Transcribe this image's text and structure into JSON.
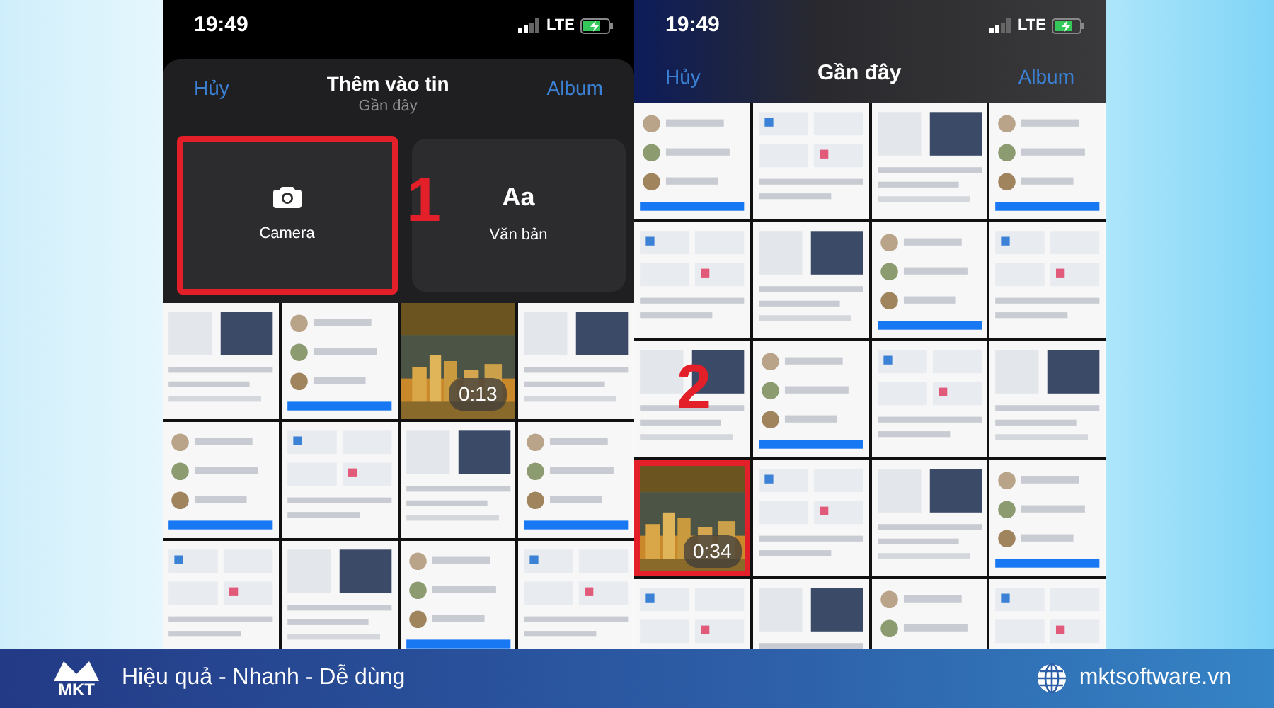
{
  "phones": [
    {
      "status": {
        "time": "19:49",
        "network": "LTE"
      },
      "header": {
        "cancel": "Hủy",
        "title": "Thêm vào tin",
        "subtitle": "Gần đây",
        "album": "Album"
      },
      "options": [
        {
          "kind": "camera",
          "label": "Camera",
          "highlighted": true
        },
        {
          "kind": "text",
          "icon": "Aa",
          "label": "Văn bản",
          "highlighted": false
        }
      ],
      "step": "1",
      "thumbnails": [
        {
          "kind": "picture",
          "highlighted": false
        },
        {
          "kind": "picture",
          "highlighted": false
        },
        {
          "kind": "picture",
          "duration": "0:13",
          "highlighted": false
        },
        {
          "kind": "picture",
          "highlighted": false
        },
        {
          "kind": "picture",
          "highlighted": false
        },
        {
          "kind": "picture",
          "highlighted": false
        },
        {
          "kind": "picture",
          "highlighted": false
        },
        {
          "kind": "picture",
          "highlighted": false
        },
        {
          "kind": "picture",
          "highlighted": false
        },
        {
          "kind": "picture",
          "highlighted": false
        },
        {
          "kind": "picture",
          "highlighted": false
        },
        {
          "kind": "picture",
          "highlighted": false
        }
      ]
    },
    {
      "status": {
        "time": "19:49",
        "network": "LTE"
      },
      "header": {
        "cancel": "Hủy",
        "title": "Gần đây",
        "album": "Album"
      },
      "step": "2",
      "thumbnails": [
        {
          "kind": "picture",
          "highlighted": false
        },
        {
          "kind": "picture",
          "highlighted": false
        },
        {
          "kind": "picture",
          "highlighted": false
        },
        {
          "kind": "picture",
          "highlighted": false
        },
        {
          "kind": "picture",
          "highlighted": false
        },
        {
          "kind": "picture",
          "highlighted": false
        },
        {
          "kind": "picture",
          "highlighted": false
        },
        {
          "kind": "picture",
          "highlighted": false
        },
        {
          "kind": "picture",
          "highlighted": false
        },
        {
          "kind": "picture",
          "highlighted": false
        },
        {
          "kind": "picture",
          "highlighted": false
        },
        {
          "kind": "picture",
          "highlighted": false
        },
        {
          "kind": "picture",
          "duration": "0:34",
          "highlighted": true
        },
        {
          "kind": "picture",
          "highlighted": false
        },
        {
          "kind": "picture",
          "highlighted": false
        },
        {
          "kind": "picture",
          "highlighted": false
        },
        {
          "kind": "picture",
          "highlighted": false
        },
        {
          "kind": "picture",
          "highlighted": false
        },
        {
          "kind": "picture",
          "highlighted": false
        },
        {
          "kind": "picture",
          "highlighted": false
        }
      ]
    }
  ],
  "banner": {
    "logo": "MKT",
    "slogan": "Hiệu quả - Nhanh - Dễ dùng",
    "website": "mktsoftware.vn"
  }
}
